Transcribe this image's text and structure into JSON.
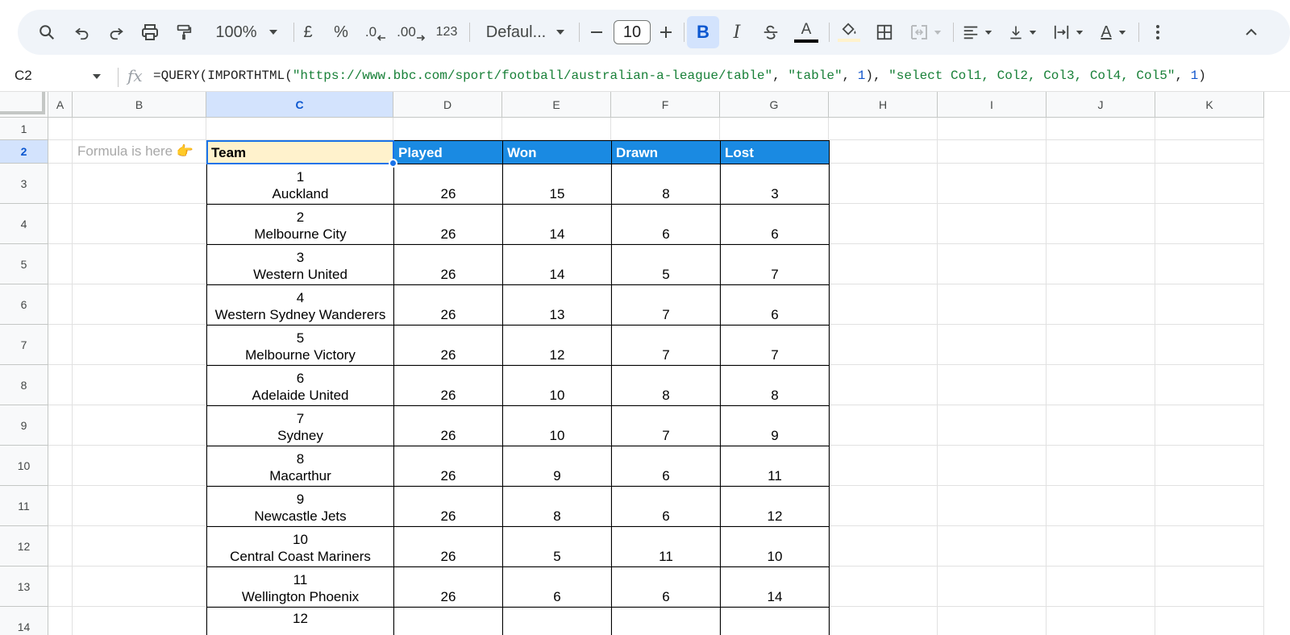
{
  "toolbar": {
    "zoom": "100%",
    "currency": "£",
    "percent": "%",
    "decrease_decimal": ".0",
    "increase_decimal": ".00",
    "number_format": "123",
    "font": "Defaul...",
    "font_size": "10",
    "bold": "B",
    "italic": "I",
    "text_color_letter": "A",
    "text_rotation_letter": "A"
  },
  "formula_bar": {
    "cell_ref": "C2",
    "fx": "fx",
    "prefix": "=QUERY(IMPORTHTML(",
    "url": "\"https://www.bbc.com/sport/football/australian-a-league/table\"",
    "sep1": ", ",
    "arg_table": "\"table\"",
    "sep2": ", ",
    "num1": "1",
    "close1": "), ",
    "query": "\"select Col1, Col2, Col3, Col4, Col5\"",
    "sep3": ", ",
    "num2": "1",
    "close2": ")"
  },
  "columns": [
    "A",
    "B",
    "C",
    "D",
    "E",
    "F",
    "G",
    "H",
    "I",
    "J",
    "K"
  ],
  "rows": [
    "1",
    "2",
    "3",
    "4",
    "5",
    "6",
    "7",
    "8",
    "9",
    "10",
    "11",
    "12",
    "13",
    "14"
  ],
  "hint": "Formula is here 👉",
  "table": {
    "headers": [
      "Team",
      "Played",
      "Won",
      "Drawn",
      "Lost"
    ],
    "rows": [
      {
        "rank": "1",
        "team": "Auckland",
        "played": "26",
        "won": "15",
        "drawn": "8",
        "lost": "3"
      },
      {
        "rank": "2",
        "team": "Melbourne City",
        "played": "26",
        "won": "14",
        "drawn": "6",
        "lost": "6"
      },
      {
        "rank": "3",
        "team": "Western United",
        "played": "26",
        "won": "14",
        "drawn": "5",
        "lost": "7"
      },
      {
        "rank": "4",
        "team": "Western Sydney Wanderers",
        "played": "26",
        "won": "13",
        "drawn": "7",
        "lost": "6"
      },
      {
        "rank": "5",
        "team": "Melbourne Victory",
        "played": "26",
        "won": "12",
        "drawn": "7",
        "lost": "7"
      },
      {
        "rank": "6",
        "team": "Adelaide United",
        "played": "26",
        "won": "10",
        "drawn": "8",
        "lost": "8"
      },
      {
        "rank": "7",
        "team": "Sydney",
        "played": "26",
        "won": "10",
        "drawn": "7",
        "lost": "9"
      },
      {
        "rank": "8",
        "team": "Macarthur",
        "played": "26",
        "won": "9",
        "drawn": "6",
        "lost": "11"
      },
      {
        "rank": "9",
        "team": "Newcastle Jets",
        "played": "26",
        "won": "8",
        "drawn": "6",
        "lost": "12"
      },
      {
        "rank": "10",
        "team": "Central Coast Mariners",
        "played": "26",
        "won": "5",
        "drawn": "11",
        "lost": "10"
      },
      {
        "rank": "11",
        "team": "Wellington Phoenix",
        "played": "26",
        "won": "6",
        "drawn": "6",
        "lost": "14"
      },
      {
        "rank": "12",
        "team": "",
        "played": "",
        "won": "",
        "drawn": "",
        "lost": ""
      }
    ]
  },
  "colors": {
    "header_blue": "#1a8ae2",
    "team_header_fill": "#fff2cc",
    "selection": "#1a73e8"
  }
}
